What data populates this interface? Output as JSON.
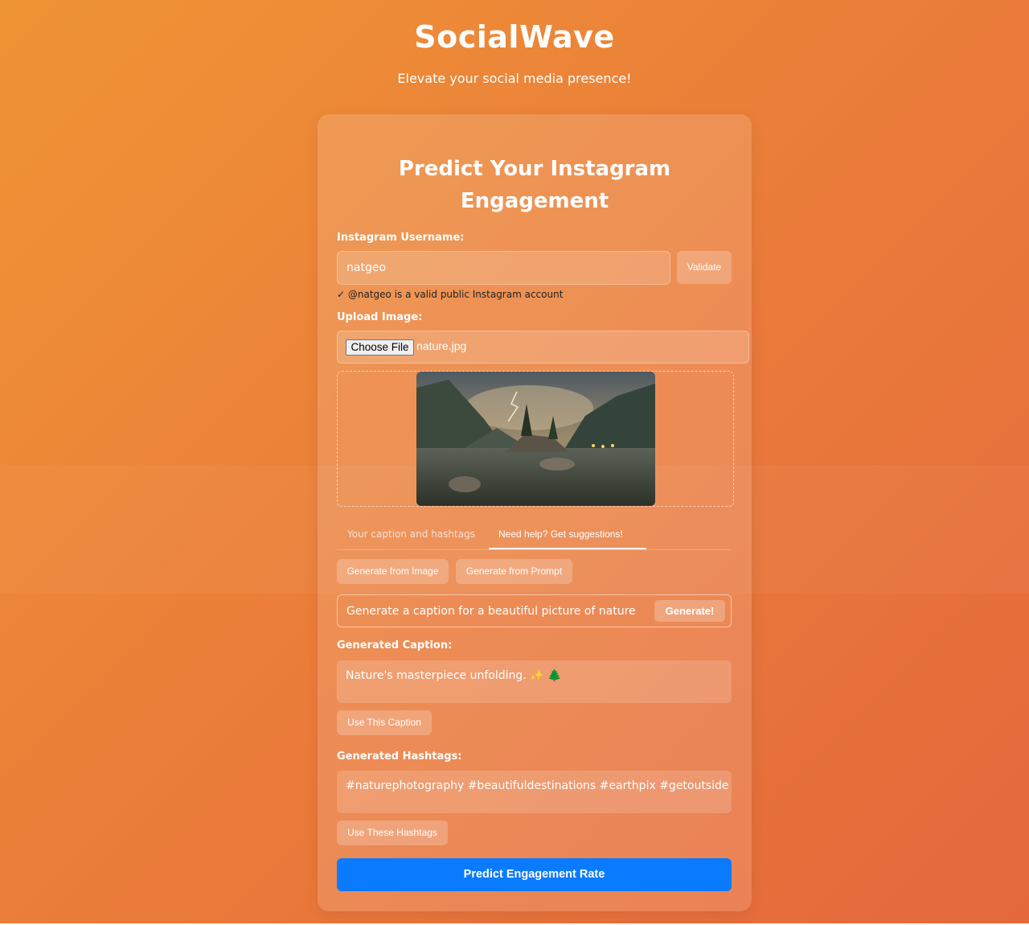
{
  "header": {
    "brand": "SocialWave",
    "tagline": "Elevate your social media presence!"
  },
  "form": {
    "title": "Predict Your Instagram Engagement",
    "username_label": "Instagram Username:",
    "username_value": "natgeo",
    "validate_label": "Validate",
    "validation_message": "✓ @natgeo is a valid public Instagram account",
    "upload_label": "Upload Image:",
    "choose_file_label": "Choose File",
    "file_name": "nature.jpg",
    "tabs": [
      {
        "label": "Your caption and hashtags",
        "active": false
      },
      {
        "label": "Need help? Get suggestions!",
        "active": true
      }
    ],
    "generate_from_image_label": "Generate from Image",
    "generate_from_prompt_label": "Generate from Prompt",
    "prompt_value": "Generate a caption for a beautiful picture of nature",
    "generate_label": "Generate!",
    "generated_caption_label": "Generated Caption:",
    "generated_caption": "Nature's masterpiece unfolding. ✨ 🌲",
    "use_caption_label": "Use This Caption",
    "generated_hashtags_label": "Generated Hashtags:",
    "generated_hashtags": "#naturephotography #beautifuldestinations #earthpix #getoutside",
    "use_hashtags_label": "Use These Hashtags",
    "predict_label": "Predict Engagement Rate"
  },
  "colors": {
    "accent": "#0a7bff",
    "background_start": "#ef9435",
    "background_end": "#e4683c"
  }
}
